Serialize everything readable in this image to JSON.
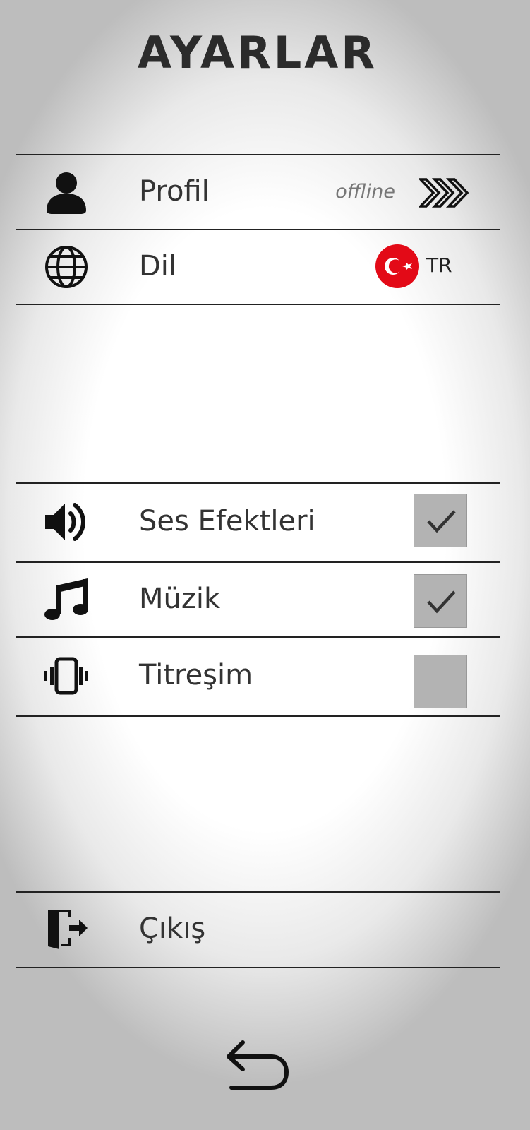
{
  "page": {
    "title": "AYARLAR"
  },
  "profile": {
    "label": "Profil",
    "status": "offline",
    "icon": "user-icon",
    "action_icon": "triple-chevron-right-icon"
  },
  "language": {
    "label": "Dil",
    "code": "TR",
    "icon": "globe-icon",
    "flag_colors": {
      "red": "#e30a17",
      "white": "#ffffff"
    }
  },
  "sound_effects": {
    "label": "Ses Efektleri",
    "checked": true,
    "icon": "speaker-icon"
  },
  "music": {
    "label": "Müzik",
    "checked": true,
    "icon": "music-note-icon"
  },
  "vibration": {
    "label": "Titreşim",
    "checked": false,
    "icon": "vibrate-icon"
  },
  "exit": {
    "label": "Çıkış",
    "icon": "exit-door-icon"
  },
  "navigation": {
    "back_icon": "back-arrow-icon"
  },
  "colors": {
    "text": "#333333",
    "divider": "#222222",
    "checkbox_bg": "#b3b3b3",
    "check_mark": "#333333"
  }
}
